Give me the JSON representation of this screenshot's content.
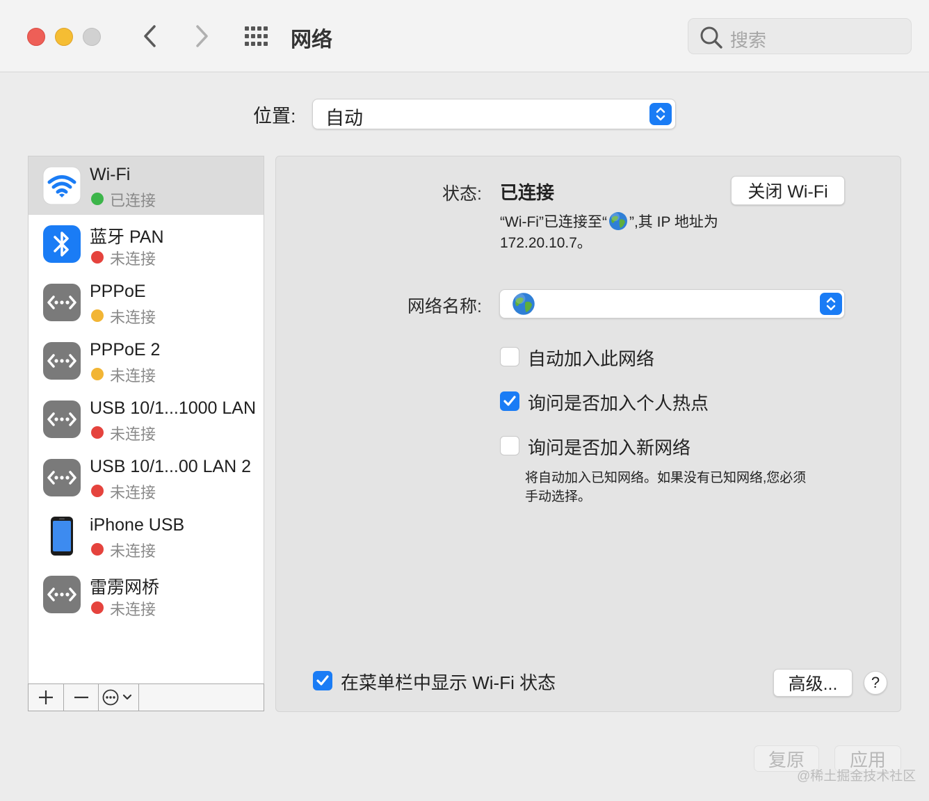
{
  "window": {
    "title": "网络"
  },
  "search": {
    "placeholder": "搜索"
  },
  "location": {
    "label": "位置:",
    "value": "自动"
  },
  "services": [
    {
      "name": "Wi-Fi",
      "status": "已连接",
      "status_color": "#3cb54a",
      "icon": "wifi-icon",
      "selected": true
    },
    {
      "name": "蓝牙 PAN",
      "status": "未连接",
      "status_color": "#e5433d",
      "icon": "bluetooth-icon",
      "selected": false
    },
    {
      "name": "PPPoE",
      "status": "未连接",
      "status_color": "#f2b534",
      "icon": "ethernet-icon",
      "selected": false
    },
    {
      "name": "PPPoE 2",
      "status": "未连接",
      "status_color": "#f2b534",
      "icon": "ethernet-icon",
      "selected": false
    },
    {
      "name": "USB 10/1...1000 LAN",
      "status": "未连接",
      "status_color": "#e5433d",
      "icon": "ethernet-icon",
      "selected": false
    },
    {
      "name": "USB 10/1...00 LAN 2",
      "status": "未连接",
      "status_color": "#e5433d",
      "icon": "ethernet-icon",
      "selected": false
    },
    {
      "name": "iPhone USB",
      "status": "未连接",
      "status_color": "#e5433d",
      "icon": "iphone-icon",
      "selected": false
    },
    {
      "name": "雷雳网桥",
      "status": "未连接",
      "status_color": "#e5433d",
      "icon": "ethernet-icon",
      "selected": false
    }
  ],
  "detail": {
    "status_label": "状态:",
    "status_value": "已连接",
    "turn_off_button": "关闭 Wi-Fi",
    "status_desc_line1": "“Wi-Fi”已连接至“",
    "status_desc_line1b": "”,其 IP 地址为",
    "status_desc_line2": "172.20.10.7。",
    "network_name_label": "网络名称:",
    "auto_join_label": "自动加入此网络",
    "auto_join_checked": false,
    "ask_hotspot_label": "询问是否加入个人热点",
    "ask_hotspot_checked": true,
    "ask_new_label": "询问是否加入新网络",
    "ask_new_checked": false,
    "ask_new_note_line1": "将自动加入已知网络。如果没有已知网络,您必须",
    "ask_new_note_line2": "手动选择。",
    "show_menubar_label": "在菜单栏中显示 Wi-Fi 状态",
    "show_menubar_checked": true,
    "advanced_button": "高级...",
    "help_button": "?"
  },
  "footer": {
    "revert_button": "复原",
    "apply_button": "应用"
  },
  "watermark": "@稀土掘金技术社区",
  "colors": {
    "accent": "#1a7cf5",
    "connected": "#3cb54a",
    "disconnected": "#e5433d",
    "inactive": "#f2b534"
  }
}
